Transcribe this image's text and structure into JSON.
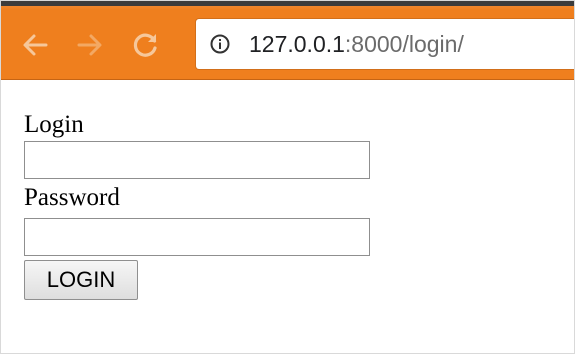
{
  "browser": {
    "url_host": "127.0.0.1",
    "url_rest": ":8000/login/",
    "accent": "#ef7f1e"
  },
  "icons": {
    "back": "back-arrow-icon",
    "forward": "forward-arrow-icon",
    "reload": "reload-icon",
    "info": "info-icon"
  },
  "form": {
    "login_label": "Login",
    "login_value": "",
    "password_label": "Password",
    "password_value": "",
    "submit_label": "LOGIN"
  }
}
